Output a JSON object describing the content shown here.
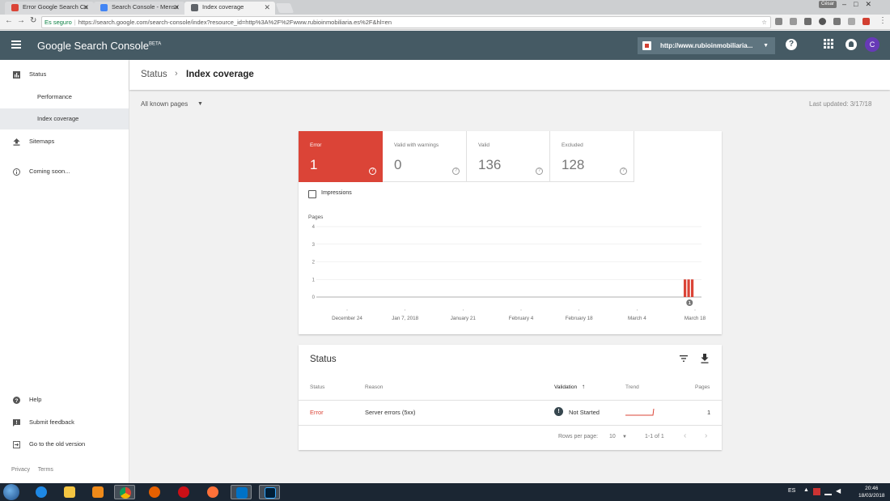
{
  "browser": {
    "tabs": [
      {
        "title": "Error Google Search Co",
        "favicon_color": "#db4437"
      },
      {
        "title": "Search Console - Mensa",
        "favicon_color": "#4285f4"
      },
      {
        "title": "Index coverage",
        "favicon_color": "#5f6368"
      }
    ],
    "user_badge": "César",
    "window_controls": "–□✕",
    "nav": {
      "back": "←",
      "forward": "→",
      "reload": "↻"
    },
    "secure_label": "Es seguro",
    "url": "https://search.google.com/search-console/index?resource_id=http%3A%2F%2Fwww.rubioinmobiliaria.es%2F&hl=en",
    "star": "☆"
  },
  "header": {
    "app_name": "Google Search Console",
    "beta": "BETA",
    "property": "http://www.rubioinmobiliaria...",
    "property_caret": "▼",
    "help": "?",
    "apps": "⋮⋮⋮",
    "avatar_letter": "C"
  },
  "sidebar": {
    "items": [
      {
        "label": "Status"
      },
      {
        "label": "Performance"
      },
      {
        "label": "Index coverage"
      },
      {
        "label": "Sitemaps"
      },
      {
        "label": "Coming soon..."
      }
    ],
    "bottom_items": [
      {
        "label": "Help"
      },
      {
        "label": "Submit feedback"
      },
      {
        "label": "Go to the old version"
      }
    ],
    "footer": {
      "privacy": "Privacy",
      "terms": "Terms"
    }
  },
  "page": {
    "breadcrumb_root": "Status",
    "breadcrumb_sep": "›",
    "title": "Index coverage",
    "filter": "All known pages",
    "filter_caret": "▼",
    "last_updated": "Last updated: 3/17/18"
  },
  "stats": [
    {
      "label": "Error",
      "value": "1",
      "color": "#db4437"
    },
    {
      "label": "Valid with warnings",
      "value": "0"
    },
    {
      "label": "Valid",
      "value": "136"
    },
    {
      "label": "Excluded",
      "value": "128"
    }
  ],
  "impressions_label": "Impressions",
  "chart_data": {
    "type": "bar",
    "ylabel": "Pages",
    "ylim": [
      0,
      4
    ],
    "yticks": [
      "4",
      "3",
      "2",
      "1",
      "0"
    ],
    "xticks": [
      "December 24",
      "Jan 7, 2018",
      "January 21",
      "February 4",
      "February 18",
      "March 4",
      "March 18"
    ],
    "series": [
      {
        "color": "#db4437",
        "values": [
          1,
          1,
          1
        ]
      }
    ],
    "annotation": "1"
  },
  "status_table": {
    "title": "Status",
    "columns": {
      "status": "Status",
      "reason": "Reason",
      "validation": "Validation",
      "sort_arrow": "↑",
      "trend": "Trend",
      "pages": "Pages"
    },
    "rows": [
      {
        "status": "Error",
        "reason": "Server errors (5xx)",
        "validation_icon": "!",
        "validation": "Not Started",
        "pages": "1"
      }
    ],
    "rows_per_page_label": "Rows per page:",
    "rows_per_page": "10",
    "range": "1-1 of 1",
    "prev": "‹",
    "next": "›"
  },
  "taskbar": {
    "lang": "ES",
    "time": "20:46",
    "date": "18/03/2018"
  }
}
